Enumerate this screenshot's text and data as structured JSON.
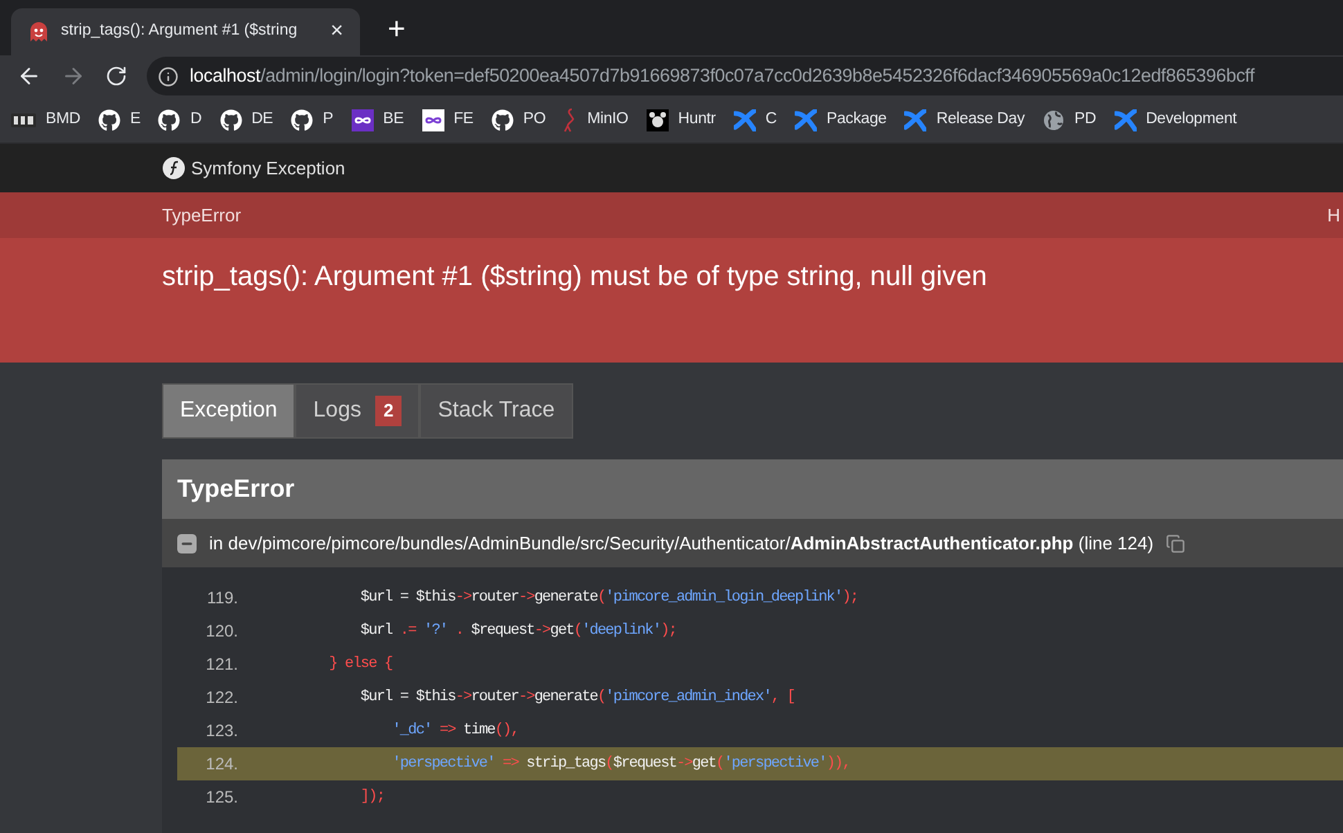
{
  "browser": {
    "tab": {
      "title": "strip_tags(): Argument #1 ($string",
      "close": "×"
    },
    "new_tab": "+",
    "url": {
      "host": "localhost",
      "path": "/admin/login/login?token=def50200ea4507d7b91669873f0c07a7cc0d2639b8e5452326f6dacf346905569a0c12edf865396bcff"
    },
    "bookmarks": [
      {
        "kind": "logo-text",
        "label": "BMD"
      },
      {
        "kind": "github",
        "label": "E"
      },
      {
        "kind": "github",
        "label": "D"
      },
      {
        "kind": "github",
        "label": "DE"
      },
      {
        "kind": "github",
        "label": "P"
      },
      {
        "kind": "infinity",
        "label": "BE"
      },
      {
        "kind": "infinity-outline",
        "label": "FE"
      },
      {
        "kind": "github",
        "label": "PO"
      },
      {
        "kind": "bird",
        "label": "MinIO"
      },
      {
        "kind": "mascot",
        "label": "Huntr"
      },
      {
        "kind": "cross",
        "label": "C"
      },
      {
        "kind": "cross",
        "label": "Package"
      },
      {
        "kind": "cross",
        "label": "Release Day"
      },
      {
        "kind": "globe",
        "label": "PD"
      },
      {
        "kind": "cross",
        "label": "Development"
      }
    ]
  },
  "header": {
    "title": "Symfony Exception"
  },
  "error": {
    "class": "TypeError",
    "status": "H",
    "message": "strip_tags(): Argument #1 ($string) must be of type string, null given"
  },
  "tabs": [
    {
      "label": "Exception",
      "selected": true
    },
    {
      "label": "Logs",
      "selected": false,
      "badge": "2"
    },
    {
      "label": "Stack Trace",
      "selected": false
    }
  ],
  "exception": {
    "title": "TypeError",
    "file_prefix": "in dev/pimcore/pimcore/bundles/AdminBundle/src/Security/Authenticator/",
    "file_name": "AdminAbstractAuthenticator.php",
    "line_info": "(line 124)",
    "expanded": true,
    "code": [
      {
        "number": "119.",
        "highlighted": false,
        "tokens": [
          {
            "kind": "plain",
            "text": "            $url = $this"
          },
          {
            "kind": "op",
            "text": "->"
          },
          {
            "kind": "plain",
            "text": "router"
          },
          {
            "kind": "op",
            "text": "->"
          },
          {
            "kind": "plain",
            "text": "generate"
          },
          {
            "kind": "op",
            "text": "("
          },
          {
            "kind": "string",
            "text": "'pimcore_admin_login_deeplink'"
          },
          {
            "kind": "op",
            "text": ");"
          }
        ]
      },
      {
        "number": "120.",
        "highlighted": false,
        "tokens": [
          {
            "kind": "plain",
            "text": "            $url "
          },
          {
            "kind": "op",
            "text": ".="
          },
          {
            "kind": "string",
            "text": " '?' "
          },
          {
            "kind": "op",
            "text": "."
          },
          {
            "kind": "plain",
            "text": " $request"
          },
          {
            "kind": "op",
            "text": "->"
          },
          {
            "kind": "plain",
            "text": "get"
          },
          {
            "kind": "op",
            "text": "("
          },
          {
            "kind": "string",
            "text": "'deeplink'"
          },
          {
            "kind": "op",
            "text": ");"
          }
        ]
      },
      {
        "number": "121.",
        "highlighted": false,
        "tokens": [
          {
            "kind": "op",
            "text": "        } else {"
          }
        ]
      },
      {
        "number": "122.",
        "highlighted": false,
        "tokens": [
          {
            "kind": "plain",
            "text": "            $url = $this"
          },
          {
            "kind": "op",
            "text": "->"
          },
          {
            "kind": "plain",
            "text": "router"
          },
          {
            "kind": "op",
            "text": "->"
          },
          {
            "kind": "plain",
            "text": "generate"
          },
          {
            "kind": "op",
            "text": "("
          },
          {
            "kind": "string",
            "text": "'pimcore_admin_index'"
          },
          {
            "kind": "op",
            "text": ", ["
          }
        ]
      },
      {
        "number": "123.",
        "highlighted": false,
        "tokens": [
          {
            "kind": "string",
            "text": "                '_dc' "
          },
          {
            "kind": "op",
            "text": "=>"
          },
          {
            "kind": "plain",
            "text": " time"
          },
          {
            "kind": "op",
            "text": "(),"
          }
        ]
      },
      {
        "number": "124.",
        "highlighted": true,
        "tokens": [
          {
            "kind": "string",
            "text": "                'perspective' "
          },
          {
            "kind": "op",
            "text": "=>"
          },
          {
            "kind": "plain",
            "text": " strip_tags"
          },
          {
            "kind": "op",
            "text": "("
          },
          {
            "kind": "plain",
            "text": "$request"
          },
          {
            "kind": "op",
            "text": "->"
          },
          {
            "kind": "plain",
            "text": "get"
          },
          {
            "kind": "op",
            "text": "("
          },
          {
            "kind": "string",
            "text": "'perspective'"
          },
          {
            "kind": "op",
            "text": ")),"
          }
        ]
      },
      {
        "number": "125.",
        "highlighted": false,
        "tokens": [
          {
            "kind": "op",
            "text": "            ]);"
          }
        ]
      }
    ]
  }
}
